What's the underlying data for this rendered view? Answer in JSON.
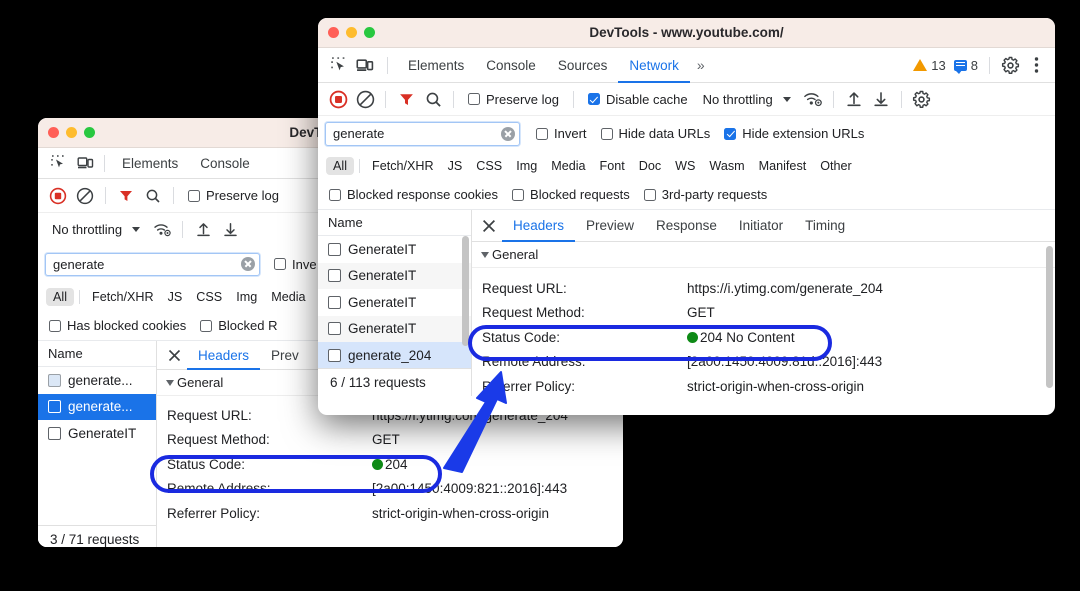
{
  "rear_window": {
    "title": "DevTools - w",
    "traffic_lights": [
      "close",
      "minimize",
      "maximize"
    ],
    "panels": [
      "Elements",
      "Console"
    ],
    "toolbar": {
      "record_icon": "record-stop-icon",
      "clear_icon": "clear-icon",
      "filter_icon": "filter-funnel-icon",
      "search_icon": "search-icon",
      "preserve_log_label": "Preserve log",
      "preserve_log_checked": false,
      "throttling_value": "No throttling",
      "wifi_icon": "network-conditions-icon",
      "import_icon": "import-har-icon",
      "export_icon": "export-har-icon"
    },
    "filter": {
      "value": "generate",
      "placeholder": "Filter",
      "invert_label": "Inve",
      "invert_checked": false
    },
    "types": [
      "All",
      "Fetch/XHR",
      "JS",
      "CSS",
      "Img",
      "Media"
    ],
    "types_selected": "All",
    "blocked": [
      {
        "label": "Has blocked cookies",
        "checked": false
      },
      {
        "label": "Blocked R",
        "checked": false
      }
    ],
    "list": {
      "column_header": "Name",
      "items": [
        {
          "name": "generate...",
          "icon": "image-file-icon",
          "selected": false
        },
        {
          "name": "generate...",
          "icon": "document-file-icon",
          "selected": true
        },
        {
          "name": "GenerateIT",
          "icon": "document-file-icon",
          "selected": false
        }
      ],
      "summary": "3 / 71 requests"
    },
    "details": {
      "close_icon": "close-icon",
      "tabs": [
        "Headers",
        "Prev"
      ],
      "selected_tab": "Headers",
      "section_title": "General",
      "rows": [
        {
          "key": "Request URL:",
          "value": "https://i.ytimg.com/generate_204"
        },
        {
          "key": "Request Method:",
          "value": "GET"
        },
        {
          "key": "Status Code:",
          "value": "204",
          "status_dot": true
        },
        {
          "key": "Remote Address:",
          "value": "[2a00:1450:4009:821::2016]:443"
        },
        {
          "key": "Referrer Policy:",
          "value": "strict-origin-when-cross-origin"
        }
      ]
    }
  },
  "front_window": {
    "title": "DevTools - www.youtube.com/",
    "traffic_lights": [
      "close",
      "minimize",
      "maximize"
    ],
    "tabbar": {
      "inspect_icon": "inspect-element-icon",
      "device_icon": "device-toolbar-icon",
      "tabs": [
        "Elements",
        "Console",
        "Sources",
        "Network"
      ],
      "selected_tab": "Network",
      "more_tabs_icon": "chevron-double-right-icon",
      "warning_icon": "warning-triangle-icon",
      "warning_count": "13",
      "message_icon": "message-icon",
      "message_count": "8",
      "settings_icon": "gear-icon",
      "menu_icon": "kebab-menu-icon"
    },
    "toolbar": {
      "record_icon": "record-stop-icon",
      "clear_icon": "clear-icon",
      "filter_icon": "filter-funnel-icon",
      "search_icon": "search-icon",
      "preserve_log_label": "Preserve log",
      "preserve_log_checked": false,
      "disable_cache_label": "Disable cache",
      "disable_cache_checked": true,
      "throttling_value": "No throttling",
      "wifi_icon": "network-conditions-icon",
      "import_icon": "import-har-icon",
      "export_icon": "export-har-icon",
      "settings_icon": "gear-icon"
    },
    "filter": {
      "value": "generate",
      "placeholder": "Filter",
      "clear_icon": "clear-input-icon",
      "invert_label": "Invert",
      "invert_checked": false,
      "hide_data_urls_label": "Hide data URLs",
      "hide_data_urls_checked": false,
      "hide_extension_urls_label": "Hide extension URLs",
      "hide_extension_urls_checked": true
    },
    "types": [
      "All",
      "Fetch/XHR",
      "JS",
      "CSS",
      "Img",
      "Media",
      "Font",
      "Doc",
      "WS",
      "Wasm",
      "Manifest",
      "Other"
    ],
    "types_selected": "All",
    "blocked": [
      {
        "label": "Blocked response cookies",
        "checked": false
      },
      {
        "label": "Blocked requests",
        "checked": false
      },
      {
        "label": "3rd-party requests",
        "checked": false
      }
    ],
    "list": {
      "column_header": "Name",
      "items": [
        {
          "name": "GenerateIT",
          "icon": "document-file-icon",
          "selected": false
        },
        {
          "name": "GenerateIT",
          "icon": "document-file-icon",
          "selected": false
        },
        {
          "name": "GenerateIT",
          "icon": "document-file-icon",
          "selected": false
        },
        {
          "name": "GenerateIT",
          "icon": "document-file-icon",
          "selected": false
        },
        {
          "name": "generate_204",
          "icon": "document-file-icon",
          "selected": true
        }
      ],
      "summary": "6 / 113 requests"
    },
    "details": {
      "close_icon": "close-icon",
      "tabs": [
        "Headers",
        "Preview",
        "Response",
        "Initiator",
        "Timing"
      ],
      "selected_tab": "Headers",
      "section_title": "General",
      "rows": [
        {
          "key": "Request URL:",
          "value": "https://i.ytimg.com/generate_204"
        },
        {
          "key": "Request Method:",
          "value": "GET"
        },
        {
          "key": "Status Code:",
          "value": "204 No Content",
          "status_dot": true
        },
        {
          "key": "Remote Address:",
          "value": "[2a00:1450:4009:81d::2016]:443"
        },
        {
          "key": "Referrer Policy:",
          "value": "strict-origin-when-cross-origin"
        }
      ]
    }
  },
  "annotations": {
    "highlight_color": "#1a2ae0",
    "arrow_color": "#1a3ae8",
    "status_dot_color": "#0e8a16",
    "highlight_rear_target": "Status Code:",
    "highlight_front_target": "Status Code:"
  }
}
